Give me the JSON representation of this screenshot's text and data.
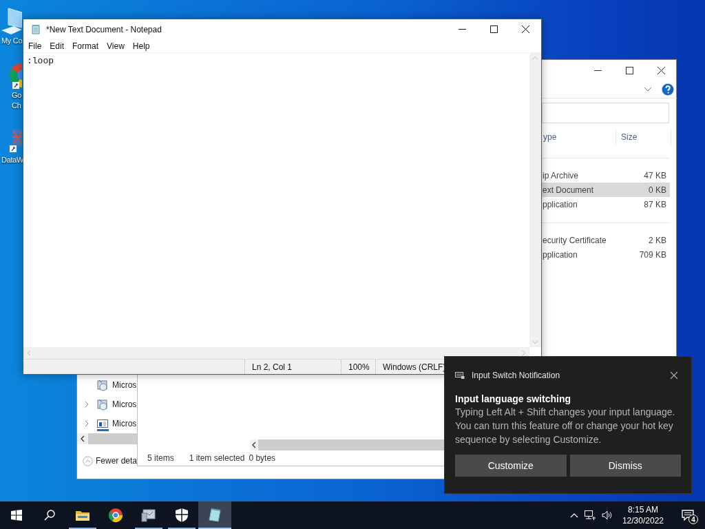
{
  "desktop_icons": [
    {
      "kind": "computer",
      "label_lines": [
        "My Co"
      ]
    },
    {
      "kind": "chrome",
      "label_lines": [
        "Go",
        "Ch"
      ]
    },
    {
      "kind": "data",
      "label_lines": [
        "DataW"
      ]
    }
  ],
  "explorer": {
    "columns": [
      "ype",
      "Size"
    ],
    "groups": [
      [
        {
          "type": "ip Archive",
          "size": "47 KB",
          "selected": false
        },
        {
          "type": "ext Document",
          "size": "0 KB",
          "selected": true
        },
        {
          "type": "pplication",
          "size": "87 KB",
          "selected": false
        }
      ],
      [
        {
          "type": "ecurity Certificate",
          "size": "2 KB",
          "selected": false
        },
        {
          "type": "pplication",
          "size": "709 KB",
          "selected": false
        }
      ]
    ],
    "nav_items": [
      {
        "kind": "disc-app",
        "label": "Micros",
        "expandable": false
      },
      {
        "kind": "disc-app",
        "label": "Micros",
        "expandable": true
      },
      {
        "kind": "window",
        "label": "Micros",
        "expandable": true
      }
    ],
    "details_toggle": "Fewer deta",
    "status": [
      "5 items",
      "1 item selected",
      "0 bytes"
    ]
  },
  "notepad": {
    "title": "*New Text Document - Notepad",
    "menu": [
      "File",
      "Edit",
      "Format",
      "View",
      "Help"
    ],
    "content": ":loop",
    "status": [
      "Ln 2, Col 1",
      "100%",
      "Windows (CRLF)"
    ]
  },
  "notification": {
    "app": "Input Switch Notification",
    "title": "Input language switching",
    "body": "Typing Left Alt + Shift changes your input language. You can turn this feature off or change your hot key sequence by selecting Customize.",
    "buttons": [
      "Customize",
      "Dismiss"
    ]
  },
  "taskbar": {
    "apps": [
      {
        "kind": "folder",
        "running": true,
        "active": false
      },
      {
        "kind": "chrome",
        "running": false,
        "active": false
      },
      {
        "kind": "monitor-app",
        "running": true,
        "active": false
      },
      {
        "kind": "shield",
        "running": true,
        "active": false
      },
      {
        "kind": "notepad",
        "running": true,
        "active": true
      }
    ],
    "time": "8:15 AM",
    "date": "12/30/2022",
    "notification_count": "4"
  }
}
